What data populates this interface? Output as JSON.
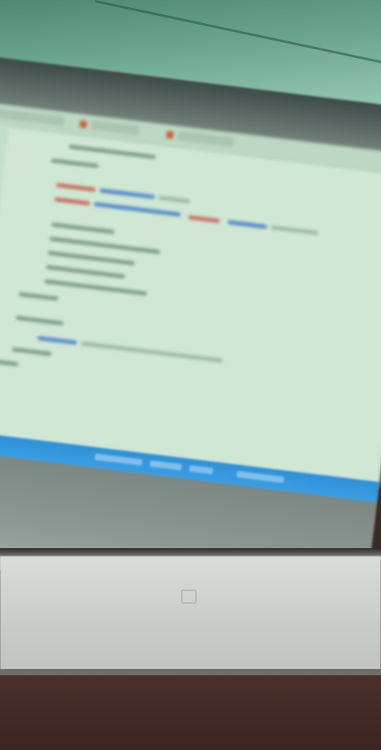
{
  "scene": {
    "description_kind": "blurred photo of a projected code editor",
    "colors": {
      "ceiling": "#6aa68c",
      "editor_background": "#cfe7d4",
      "taskbar": "#2f8fd6",
      "projector_housing": "#d9dcd8",
      "desk": "#4b2f2a"
    }
  }
}
